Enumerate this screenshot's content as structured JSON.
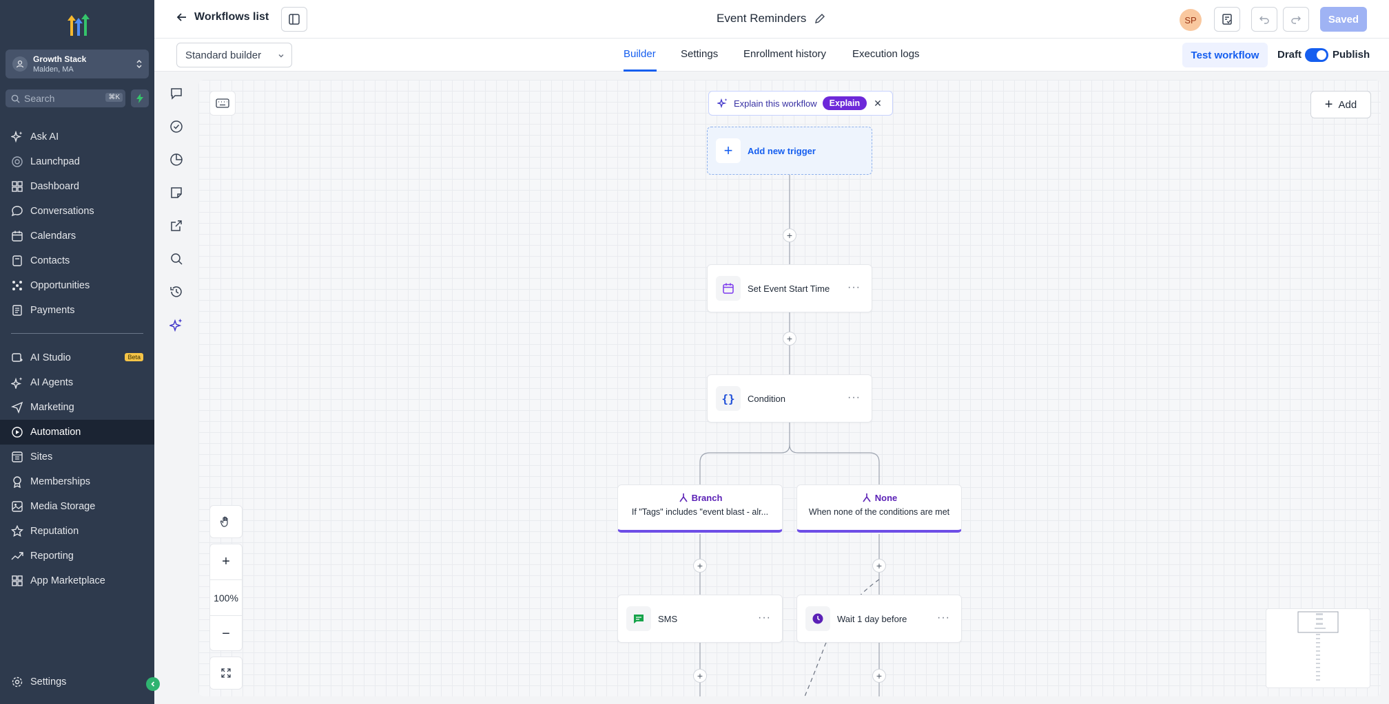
{
  "sidebar": {
    "account": {
      "name": "Growth Stack",
      "location": "Malden, MA"
    },
    "search": {
      "placeholder": "Search",
      "shortcut": "⌘K"
    },
    "items": [
      {
        "label": "Ask AI"
      },
      {
        "label": "Launchpad"
      },
      {
        "label": "Dashboard"
      },
      {
        "label": "Conversations"
      },
      {
        "label": "Calendars"
      },
      {
        "label": "Contacts"
      },
      {
        "label": "Opportunities"
      },
      {
        "label": "Payments"
      },
      {
        "label": "AI Studio",
        "badge": "Beta"
      },
      {
        "label": "AI Agents"
      },
      {
        "label": "Marketing"
      },
      {
        "label": "Automation"
      },
      {
        "label": "Sites"
      },
      {
        "label": "Memberships"
      },
      {
        "label": "Media Storage"
      },
      {
        "label": "Reputation"
      },
      {
        "label": "Reporting"
      },
      {
        "label": "App Marketplace"
      }
    ],
    "settings_label": "Settings"
  },
  "topbar": {
    "back_label": "Workflows list",
    "workflow_title": "Event Reminders",
    "user_initials": "SP",
    "saved_label": "Saved"
  },
  "subbar": {
    "builder_select": "Standard builder",
    "tabs": [
      {
        "label": "Builder"
      },
      {
        "label": "Settings"
      },
      {
        "label": "Enrollment history"
      },
      {
        "label": "Execution logs"
      }
    ],
    "test_label": "Test workflow",
    "draft_label": "Draft",
    "publish_label": "Publish"
  },
  "canvas": {
    "explain_label": "Explain this workflow",
    "explain_button": "Explain",
    "add_label": "Add",
    "trigger_label": "Add new trigger",
    "nodes": {
      "set_event": "Set Event Start Time",
      "condition": "Condition",
      "branch_title": "Branch",
      "branch_desc": "If \"Tags\" includes \"event blast - alr...",
      "none_title": "None",
      "none_desc": "When none of the conditions are met",
      "sms": "SMS",
      "wait": "Wait 1 day before"
    },
    "zoom": "100%"
  },
  "colors": {
    "sidebar_bg": "#2e3a4d",
    "accent": "#155eef",
    "branch_accent": "#6d4ee6"
  }
}
